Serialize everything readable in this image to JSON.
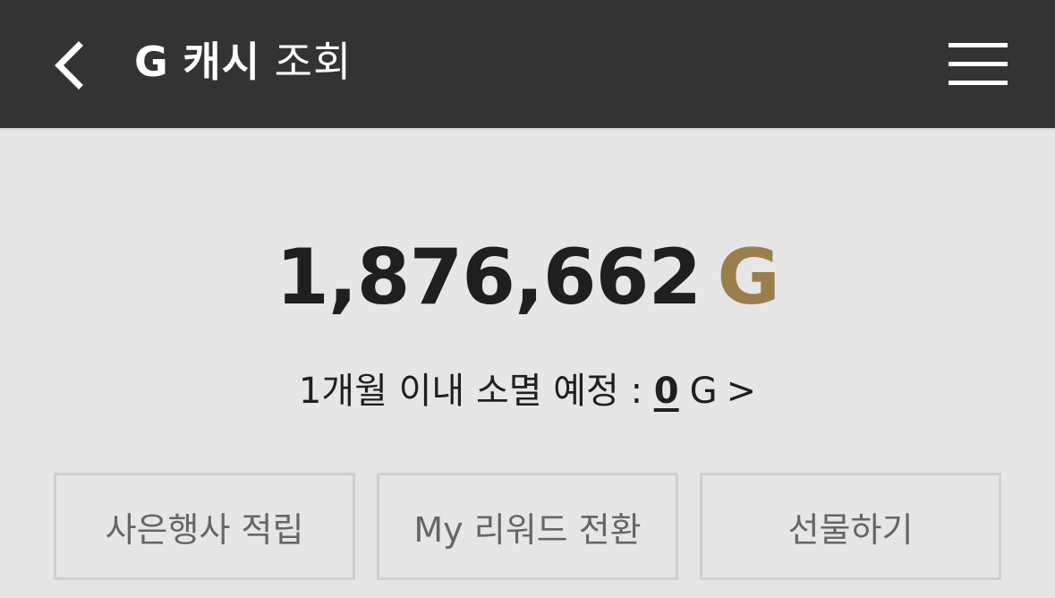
{
  "header": {
    "back_icon": "chevron-left-icon",
    "title_g": "G",
    "title_strong": "캐시",
    "title_rest": "조회",
    "menu_icon": "hamburger-menu-icon",
    "background_color": "#333333"
  },
  "balance": {
    "amount": "1,876,662",
    "unit": "G",
    "unit_color": "#9a7f4c"
  },
  "expiry": {
    "label": "1개월 이내 소멸 예정 :",
    "amount": "0",
    "unit": "G",
    "chevron": ">"
  },
  "actions": [
    {
      "label": "사은행사 적립"
    },
    {
      "label": "My 리워드 전환"
    },
    {
      "label": "선물하기"
    }
  ]
}
